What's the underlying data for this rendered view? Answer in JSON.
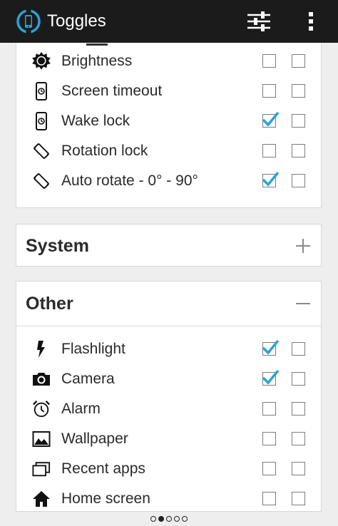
{
  "app": {
    "title": "Toggles",
    "accent_color": "#29a3d9"
  },
  "top_section": {
    "rows": [
      {
        "label": "Brightness",
        "icon": "brightness-icon",
        "checked_1": false,
        "checked_2": false
      },
      {
        "label": "Screen timeout",
        "icon": "screen-timeout-icon",
        "checked_1": false,
        "checked_2": false
      },
      {
        "label": "Wake lock",
        "icon": "wake-lock-icon",
        "checked_1": true,
        "checked_2": false
      },
      {
        "label": "Rotation lock",
        "icon": "rotation-lock-icon",
        "checked_1": false,
        "checked_2": false
      },
      {
        "label": "Auto rotate - 0° - 90°",
        "icon": "auto-rotate-icon",
        "checked_1": true,
        "checked_2": false
      }
    ]
  },
  "system_section": {
    "title": "System",
    "expanded": false
  },
  "other_section": {
    "title": "Other",
    "expanded": true,
    "rows": [
      {
        "label": "Flashlight",
        "icon": "flashlight-icon",
        "checked_1": true,
        "checked_2": false
      },
      {
        "label": "Camera",
        "icon": "camera-icon",
        "checked_1": true,
        "checked_2": false
      },
      {
        "label": "Alarm",
        "icon": "alarm-icon",
        "checked_1": false,
        "checked_2": false
      },
      {
        "label": "Wallpaper",
        "icon": "wallpaper-icon",
        "checked_1": false,
        "checked_2": false
      },
      {
        "label": "Recent apps",
        "icon": "recent-apps-icon",
        "checked_1": false,
        "checked_2": false
      },
      {
        "label": "Home screen",
        "icon": "home-screen-icon",
        "checked_1": false,
        "checked_2": false
      }
    ]
  },
  "pager": {
    "pages": 5,
    "active_index": 1
  }
}
